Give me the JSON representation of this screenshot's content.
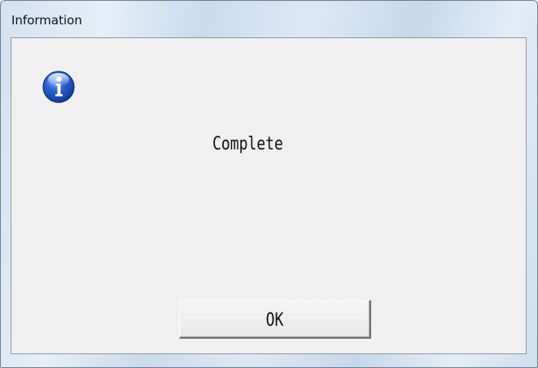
{
  "window": {
    "title": "Information"
  },
  "dialog": {
    "icon": "info-icon",
    "message": "Complete",
    "ok_label": "OK"
  },
  "colors": {
    "icon_blue": "#2a5fc9",
    "client_bg": "#f0f0f0"
  }
}
